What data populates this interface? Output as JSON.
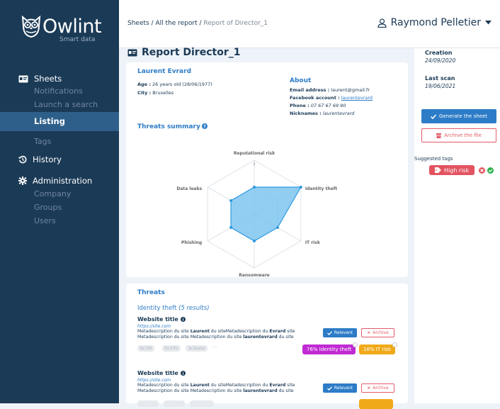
{
  "brand": {
    "name": "Owlint",
    "tagline": "Smart data"
  },
  "nav": {
    "sheets": "Sheets",
    "notifications": "Notifications",
    "launch": "Launch a search",
    "listing": "Listing",
    "tags": "Tags",
    "history": "History",
    "administration": "Administration",
    "company": "Company",
    "groups": "Groups",
    "users": "Users"
  },
  "breadcrumb": {
    "a": "Sheets",
    "b": "All the report",
    "c": "Report of Director_1"
  },
  "user": {
    "name": "Raymond Pelletier"
  },
  "page": {
    "title": "Report Director_1"
  },
  "profile": {
    "name": "Laurent Evrard",
    "age_label": "Age :",
    "age_value": " 26 years old (28/06/1977)",
    "city_label": "City :",
    "city_value": " Bruxelles",
    "about": "About",
    "email_label": "Email address :",
    "email_value": " laurent@gmail.fr",
    "fb_label": "Facebook account :",
    "fb_value": "laurentevrard",
    "phone_label": "Phone :",
    "phone_value": " 07 67 67 69 90",
    "nick_label": "Nicknames :",
    "nick_value": " laurentevrard"
  },
  "threats_summary": {
    "title": "Threats summary",
    "axes": [
      "Reputational risk",
      "Identity theft",
      "IT risk",
      "Ransomware",
      "Phishing",
      "Data leaks"
    ],
    "scale_label": "2",
    "values": [
      1,
      2,
      1,
      1,
      1,
      1
    ],
    "max": 2,
    "fill": "#7fc4f0",
    "stroke": "#2d9ae0"
  },
  "threats": {
    "title": "Threats",
    "group_label": "Identity theft",
    "group_count": "(5 results)",
    "items": [
      {
        "title": "Website title",
        "url": "https://site.com",
        "desc_parts": [
          "Metadescription du site ",
          "Laurent",
          " du siteMetadescription du ",
          "Evrard",
          " site Metadescription du site Metadescription du site ",
          "laurentevrard",
          " du site"
        ],
        "relevant": "Relevent",
        "archive": "Archive",
        "chips": [
          "8x CNI",
          "5x CVV",
          "3x Dump",
          "···"
        ],
        "pct1": "76% Identity theft",
        "pct2": "16% IT risk"
      },
      {
        "title": "Website title",
        "url": "https://site.com",
        "desc_parts": [
          "Metadescription du site ",
          "Laurent",
          " du siteMetadescription du ",
          "Evrard",
          " site Metadescription du site Metadescription du site ",
          "laurentevrard",
          " du site"
        ],
        "relevant": "Relevent",
        "archive": "Archive"
      }
    ]
  },
  "right": {
    "creation_label": "Creation",
    "creation_value": "24/09/2020",
    "scan_label": "Last scan",
    "scan_value": "19/06/2021",
    "generate": "Generate the sheet",
    "archive": "Archive the file",
    "suggested": "Suggested tags",
    "tag": "High risk"
  },
  "colors": {
    "sidebar": "#1b3a56",
    "accent": "#2d7cc7",
    "danger": "#e2535f",
    "magenta": "#c02bd3",
    "orange": "#f0a919",
    "green": "#2bb24c"
  }
}
